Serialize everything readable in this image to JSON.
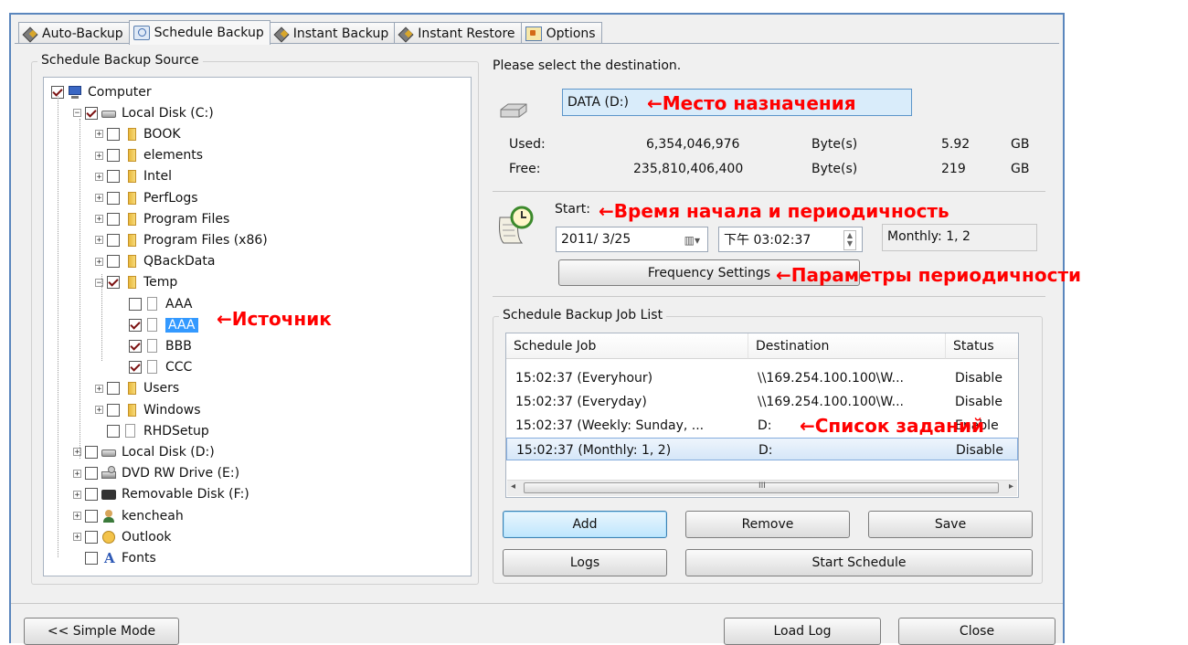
{
  "tabs": [
    {
      "label": "Auto-Backup",
      "icon": "auto-backup-icon"
    },
    {
      "label": "Schedule Backup",
      "icon": "schedule-icon",
      "active": true
    },
    {
      "label": "Instant Backup",
      "icon": "instant-backup-icon"
    },
    {
      "label": "Instant Restore",
      "icon": "instant-restore-icon"
    },
    {
      "label": "Options",
      "icon": "options-icon"
    }
  ],
  "source": {
    "title": "Schedule Backup Source",
    "tree": [
      {
        "label": "Computer",
        "checked": true,
        "icon": "computer"
      },
      {
        "label": "Local Disk (C:)",
        "checked": true,
        "icon": "disk"
      },
      {
        "label": "BOOK",
        "checked": false,
        "icon": "folder"
      },
      {
        "label": "elements",
        "checked": false,
        "icon": "folder"
      },
      {
        "label": "Intel",
        "checked": false,
        "icon": "folder"
      },
      {
        "label": "PerfLogs",
        "checked": false,
        "icon": "folder"
      },
      {
        "label": "Program Files",
        "checked": false,
        "icon": "folder"
      },
      {
        "label": "Program Files (x86)",
        "checked": false,
        "icon": "folder"
      },
      {
        "label": "QBackData",
        "checked": false,
        "icon": "folder"
      },
      {
        "label": "Temp",
        "checked": true,
        "icon": "folder"
      },
      {
        "label": "AAA",
        "checked": false,
        "icon": "file"
      },
      {
        "label": "AAA",
        "checked": true,
        "icon": "file",
        "selected": true
      },
      {
        "label": "BBB",
        "checked": true,
        "icon": "file"
      },
      {
        "label": "CCC",
        "checked": true,
        "icon": "file"
      },
      {
        "label": "Users",
        "checked": false,
        "icon": "folder"
      },
      {
        "label": "Windows",
        "checked": false,
        "icon": "folder"
      },
      {
        "label": "RHDSetup",
        "checked": false,
        "icon": "file"
      },
      {
        "label": "Local Disk (D:)",
        "checked": false,
        "icon": "disk"
      },
      {
        "label": "DVD RW Drive (E:)",
        "checked": false,
        "icon": "dvd"
      },
      {
        "label": "Removable Disk (F:)",
        "checked": false,
        "icon": "removable"
      },
      {
        "label": "kencheah",
        "checked": false,
        "icon": "user"
      },
      {
        "label": "Outlook",
        "checked": false,
        "icon": "outlook"
      },
      {
        "label": "Fonts",
        "checked": false,
        "icon": "fonts"
      }
    ]
  },
  "destination": {
    "prompt": "Please select the destination.",
    "value": "DATA (D:)",
    "used_label": "Used:",
    "used_bytes": "6,354,046,976",
    "free_label": "Free:",
    "free_bytes": "235,810,406,400",
    "bytes_unit": "Byte(s)",
    "used_size": "5.92",
    "free_size": "219",
    "size_unit": "GB"
  },
  "schedule": {
    "start_label": "Start:",
    "date": "2011/ 3/25",
    "time": "下午 03:02:37",
    "frequency_display": "Monthly: 1, 2",
    "frequency_button": "Frequency Settings"
  },
  "job_list": {
    "title": "Schedule Backup Job List",
    "columns": [
      "Schedule Job",
      "Destination",
      "Status"
    ],
    "rows": [
      {
        "job": "15:02:37 (Everyhour)",
        "destination": "\\\\169.254.100.100\\W...",
        "status": "Disable"
      },
      {
        "job": "15:02:37 (Everyday)",
        "destination": "\\\\169.254.100.100\\W...",
        "status": "Disable"
      },
      {
        "job": "15:02:37 (Weekly: Sunday, ...",
        "destination": "D:",
        "status": "Enable"
      },
      {
        "job": "15:02:37 (Monthly: 1, 2)",
        "destination": "D:",
        "status": "Disable",
        "selected": true
      }
    ],
    "scroll_grip": "III"
  },
  "buttons": {
    "add": "Add",
    "remove": "Remove",
    "save": "Save",
    "logs": "Logs",
    "start_schedule": "Start Schedule",
    "simple_mode": "<< Simple Mode",
    "load_log": "Load Log",
    "close": "Close"
  },
  "annotations": {
    "destination": "←Место назначения",
    "start": "←Время начала и периодичность",
    "frequency": "←Параметры периодичности",
    "source": "←Источник",
    "job_list": "←Список заданий"
  },
  "colors": {
    "annotation": "#ff0000",
    "selection": "#3399ff",
    "window_border": "#5a86bd"
  }
}
